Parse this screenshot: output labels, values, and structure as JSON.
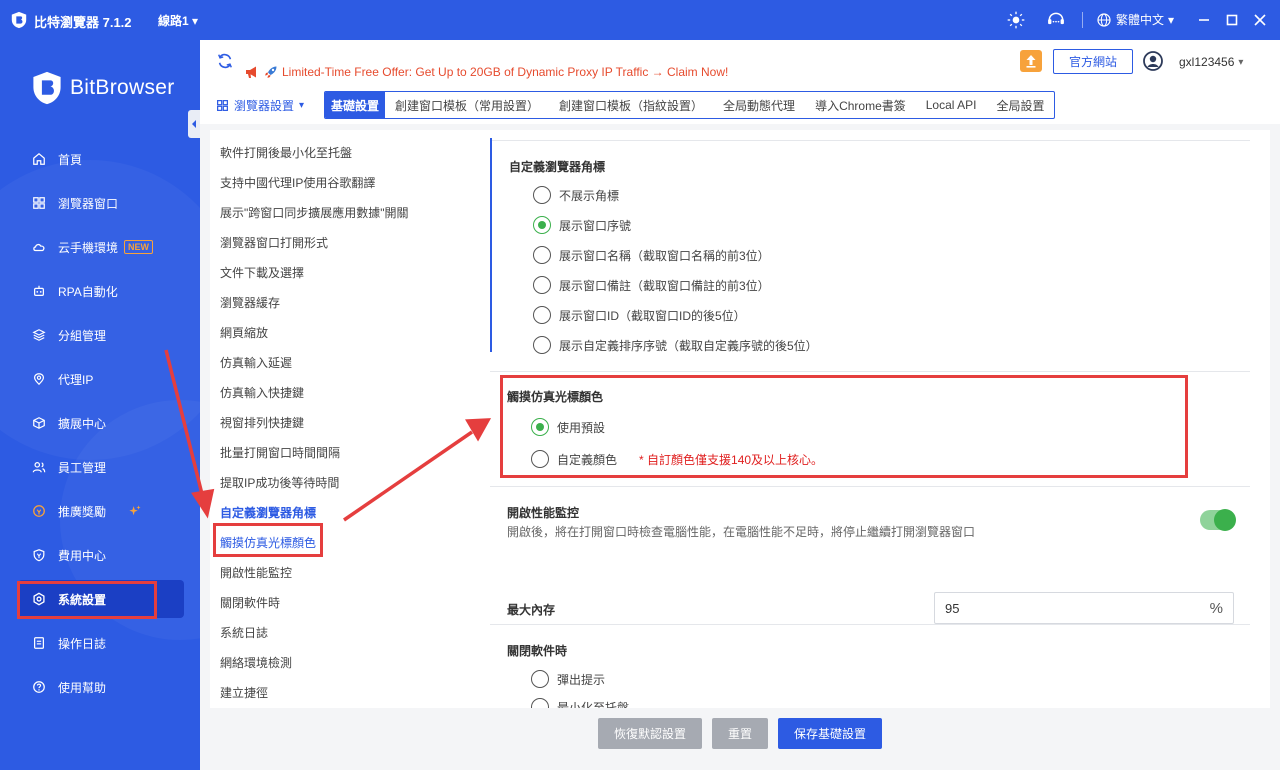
{
  "app": {
    "title": "比特瀏覽器 7.1.2",
    "line": "線路1"
  },
  "titlebar": {
    "language": "繁體中文"
  },
  "brand": {
    "name": "BitBrowser"
  },
  "sidebar": {
    "items": [
      {
        "label": "首頁",
        "icon": "home-icon"
      },
      {
        "label": "瀏覽器窗口",
        "icon": "grid-icon"
      },
      {
        "label": "云手機環境",
        "icon": "cloud-icon",
        "badge": "NEW"
      },
      {
        "label": "RPA自動化",
        "icon": "robot-icon"
      },
      {
        "label": "分組管理",
        "icon": "layers-icon"
      },
      {
        "label": "代理IP",
        "icon": "location-icon"
      },
      {
        "label": "擴展中心",
        "icon": "cube-icon"
      },
      {
        "label": "員工管理",
        "icon": "users-icon"
      },
      {
        "label": "推廣獎勵",
        "icon": "reward-icon"
      },
      {
        "label": "費用中心",
        "icon": "shield-icon"
      },
      {
        "label": "系統設置",
        "icon": "gear-icon",
        "active": true
      },
      {
        "label": "操作日誌",
        "icon": "log-icon"
      },
      {
        "label": "使用幫助",
        "icon": "help-icon"
      }
    ]
  },
  "header": {
    "promo": "Limited-Time Free Offer: Get Up to 20GB of Dynamic Proxy IP Traffic → Claim Now!",
    "official_site": "官方網站",
    "username": "gxl123456"
  },
  "subheader": {
    "section": "瀏覽器設置",
    "tabs": [
      {
        "label": "基礎設置",
        "active": true
      },
      {
        "label": "創建窗口模板（常用設置）"
      },
      {
        "label": "創建窗口模板（指紋設置）"
      },
      {
        "label": "全局動態代理"
      },
      {
        "label": "導入Chrome書簽"
      },
      {
        "label": "Local API"
      },
      {
        "label": "全局設置"
      }
    ]
  },
  "settings_list": [
    "軟件打開後最小化至托盤",
    "支持中國代理IP使用谷歌翻譯",
    "展示\"跨窗口同步擴展應用數據\"開關",
    "瀏覽器窗口打開形式",
    "文件下載及選擇",
    "瀏覽器緩存",
    "網頁縮放",
    "仿真輸入延遲",
    "仿真輸入快捷鍵",
    "視窗排列快捷鍵",
    "批量打開窗口時間間隔",
    "提取IP成功後等待時間",
    "自定義瀏覽器角標",
    "觸摸仿真光標顏色",
    "開啟性能監控",
    "關閉軟件時",
    "系統日誌",
    "網絡環境檢測",
    "建立捷徑"
  ],
  "panel": {
    "corner": {
      "title": "自定義瀏覽器角標",
      "options": [
        {
          "label": "不展示角標",
          "checked": false
        },
        {
          "label": "展示窗口序號",
          "checked": true
        },
        {
          "label": "展示窗口名稱（截取窗口名稱的前3位）",
          "checked": false
        },
        {
          "label": "展示窗口備註（截取窗口備註的前3位）",
          "checked": false
        },
        {
          "label": "展示窗口ID（截取窗口ID的後5位）",
          "checked": false
        },
        {
          "label": "展示自定義排序序號（截取自定義序號的後5位）",
          "checked": false
        }
      ]
    },
    "cursor": {
      "title": "觸摸仿真光標顏色",
      "options": [
        {
          "label": "使用預設",
          "checked": true
        },
        {
          "label": "自定義顏色",
          "checked": false
        }
      ],
      "hint": "* 自訂顏色僅支援140及以上核心。"
    },
    "perf": {
      "title": "開啟性能監控",
      "desc": "開啟後，將在打開窗口時檢查電腦性能，在電腦性能不足時，將停止繼續打開瀏覽器窗口",
      "enabled": true,
      "mem_label": "最大內存",
      "mem_value": "95",
      "mem_unit": "%"
    },
    "close": {
      "title": "關閉軟件時",
      "options": [
        {
          "label": "彈出提示",
          "checked": false
        },
        {
          "label": "最小化至托盤",
          "checked": false
        }
      ]
    }
  },
  "footer": {
    "restore": "恢復默認設置",
    "reset": "重置",
    "save": "保存基礎設置"
  },
  "colors": {
    "primary": "#2d5be3",
    "accent_green": "#3bb04c",
    "warning_red": "#e53e3e",
    "badge_orange": "#f7a23b"
  }
}
